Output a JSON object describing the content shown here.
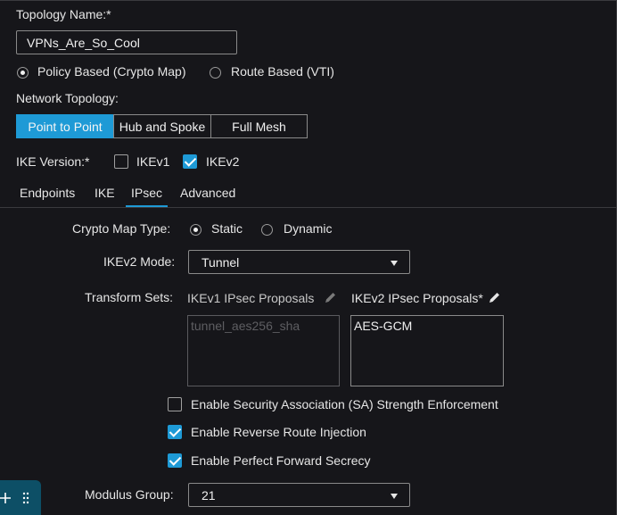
{
  "topology": {
    "name_label": "Topology Name:*",
    "name_value": "VPNs_Are_So_Cool"
  },
  "vpn_type": {
    "options": [
      "Policy Based (Crypto Map)",
      "Route Based (VTI)"
    ],
    "selected": "Policy Based (Crypto Map)"
  },
  "network_topology": {
    "label": "Network Topology:",
    "options": [
      "Point to Point",
      "Hub and Spoke",
      "Full Mesh"
    ],
    "selected": "Point to Point"
  },
  "ike_version": {
    "label": "IKE Version:*",
    "ikev1": "IKEv1",
    "ikev1_checked": false,
    "ikev2": "IKEv2",
    "ikev2_checked": true
  },
  "tabs": [
    "Endpoints",
    "IKE",
    "IPsec",
    "Advanced"
  ],
  "active_tab": "IPsec",
  "ipsec": {
    "crypto_map_type_label": "Crypto Map Type:",
    "crypto_map_options": [
      "Static",
      "Dynamic"
    ],
    "crypto_map_selected": "Static",
    "ikev2_mode_label": "IKEv2 Mode:",
    "ikev2_mode_value": "Tunnel",
    "transform_sets_label": "Transform Sets:",
    "ikev1_proposals_label": "IKEv1 IPsec Proposals",
    "ikev1_proposals": [
      "tunnel_aes256_sha"
    ],
    "ikev2_proposals_label": "IKEv2 IPsec Proposals*",
    "ikev2_proposals": [
      "AES-GCM"
    ],
    "sa_strength_label": "Enable Security Association (SA) Strength Enforcement",
    "sa_strength_checked": false,
    "rri_label": "Enable Reverse Route Injection",
    "rri_checked": true,
    "pfs_label": "Enable Perfect Forward Secrecy",
    "pfs_checked": true,
    "modulus_group_label": "Modulus Group:",
    "modulus_group_value": "21"
  },
  "colors": {
    "accent": "#1e9ad6",
    "background": "#16161a",
    "floater": "#0d4f66"
  },
  "icons": {
    "edit": "pencil-icon",
    "dropdown": "caret-down-icon",
    "floater_add": "plus-icon",
    "floater_drag": "drag-handle-icon"
  }
}
